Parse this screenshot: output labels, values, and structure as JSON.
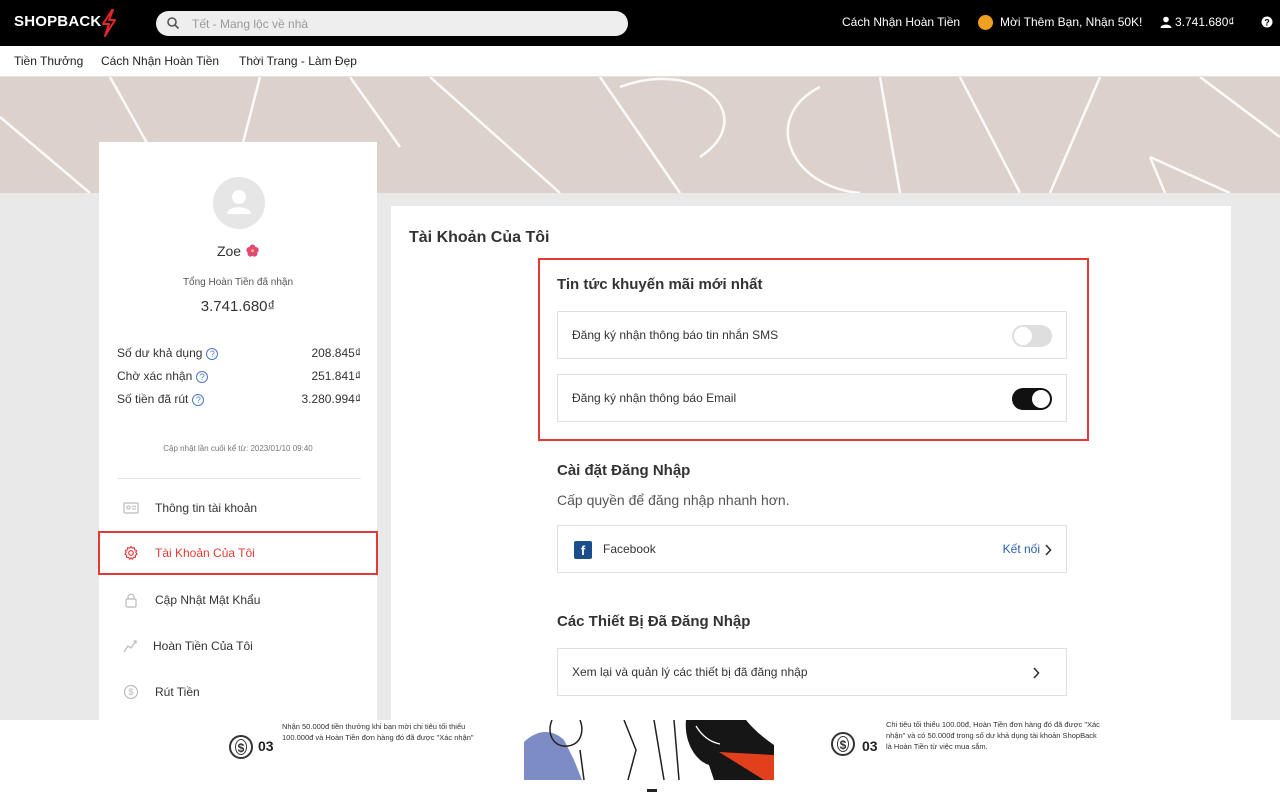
{
  "header": {
    "logo": "SHOPBACK",
    "search_placeholder": "Tết - Mang lộc về nhà",
    "links": {
      "how_cashback": "Cách Nhận Hoàn Tiền",
      "invite": "Mời Thêm Bạn, Nhận 50K!",
      "balance": "3.741.680₫"
    }
  },
  "nav": {
    "items": [
      "Tiền Thưởng",
      "Cách Nhận Hoàn Tiền",
      "Thời Trang - Làm Đẹp"
    ]
  },
  "profile": {
    "name": "Zoe",
    "total_label": "Tổng Hoàn Tiền đã nhận",
    "total_value": "3.741.680₫",
    "stats": [
      {
        "label": "Số dư khả dụng",
        "value": "208.845₫"
      },
      {
        "label": "Chờ xác nhận",
        "value": "251.841₫"
      },
      {
        "label": "Số tiền đã rút",
        "value": "3.280.994₫"
      }
    ],
    "updated": "Cập nhật lần cuối kể từ: 2023/01/10 09:40"
  },
  "menu": {
    "items": [
      {
        "label": "Thông tin tài khoản",
        "icon": "id-card-icon"
      },
      {
        "label": "Tài Khoản Của Tôi",
        "icon": "gear-icon",
        "active": true
      },
      {
        "label": "Cập Nhật Mật Khẩu",
        "icon": "lock-icon"
      },
      {
        "label": "Hoàn Tiền Của Tôi",
        "icon": "chart-icon"
      },
      {
        "label": "Rút Tiền",
        "icon": "money-icon"
      }
    ]
  },
  "main": {
    "title": "Tài Khoản Của Tôi",
    "promo": {
      "title": "Tin tức khuyến mãi mới nhất",
      "sms_label": "Đăng ký nhận thông báo tin nhắn SMS",
      "sms_enabled": false,
      "email_label": "Đăng ký nhận thông báo Email",
      "email_enabled": true
    },
    "login": {
      "title": "Cài đặt Đăng Nhập",
      "subtitle": "Cấp quyền để đăng nhập nhanh hơn.",
      "facebook_label": "Facebook",
      "connect_label": "Kết nối"
    },
    "devices": {
      "title": "Các Thiết Bị Đã Đăng Nhập",
      "manage_label": "Xem lại và quản lý các thiết bị đã đăng nhập"
    }
  },
  "banner": {
    "left_step": "03",
    "left_text": "Nhận 50.000đ tiền thưởng khi bạn mời chi tiêu tối thiểu 100.000đ và Hoàn Tiền đơn hàng đó đã được \"Xác nhận\"",
    "right_step": "03",
    "right_text": "Chi tiêu tối thiểu 100.00đ, Hoàn Tiền đơn hàng đó đã được \"Xác nhận\" và có 50.000đ trong số dư khả dụng tài khoản ShopBack là Hoàn Tiền từ việc mua sắm."
  },
  "colors": {
    "accent_red": "#e53935",
    "link_blue": "#2c5fa8",
    "facebook_blue": "#1b4e8c",
    "hero_bg": "#dcd1cb"
  }
}
